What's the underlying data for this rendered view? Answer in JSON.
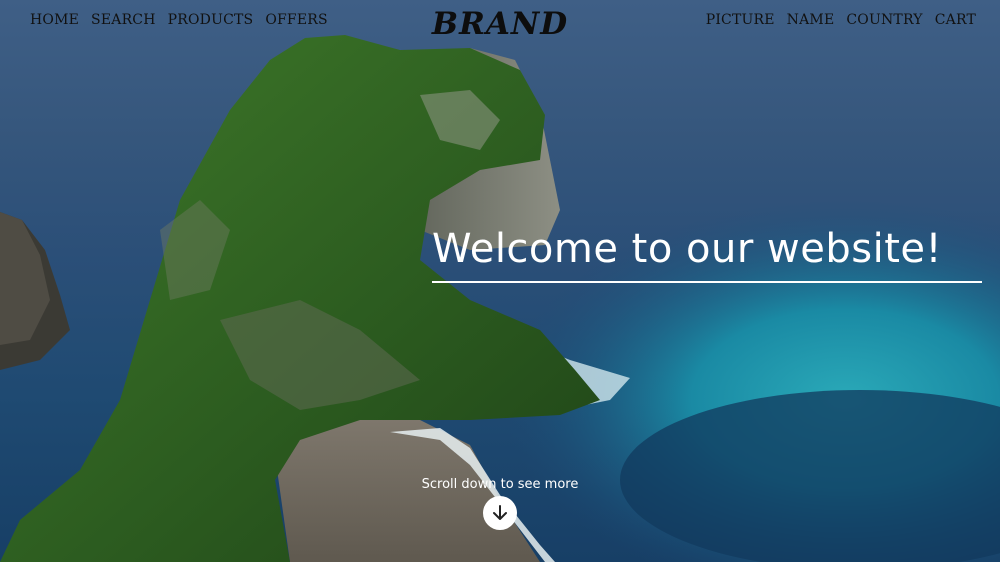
{
  "nav_left": [
    {
      "label": "HOME"
    },
    {
      "label": "SEARCH"
    },
    {
      "label": "PRODUCTS"
    },
    {
      "label": "OFFERS"
    }
  ],
  "brand": "BRAND",
  "nav_right": [
    {
      "label": "PICTURE"
    },
    {
      "label": "NAME"
    },
    {
      "label": "COUNTRY"
    },
    {
      "label": "CART"
    }
  ],
  "hero": {
    "headline": "Welcome to our website!",
    "scroll_text": "Scroll down to see more",
    "scroll_icon": "arrow-down-icon",
    "image_subject": "sea-cliff-photo"
  },
  "colors": {
    "nav_text": "#111111",
    "headline_text": "#ffffff",
    "scroll_button": "#ffffff"
  }
}
